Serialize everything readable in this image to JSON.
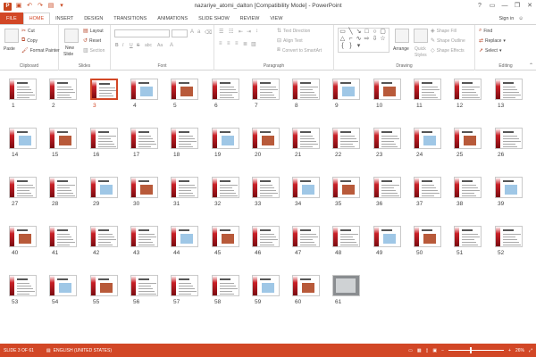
{
  "window": {
    "title": "nazariye_atomi_dalton [Compatibility Mode] - PowerPoint",
    "app_icon": "P",
    "minimize": "—",
    "restore": "❐",
    "close": "✕",
    "help": "?",
    "ribbon_toggle": "▭"
  },
  "tabs": [
    "FILE",
    "HOME",
    "INSERT",
    "DESIGN",
    "TRANSITIONS",
    "ANIMATIONS",
    "SLIDE SHOW",
    "REVIEW",
    "VIEW"
  ],
  "active_tab": "HOME",
  "signin": {
    "label": "Sign in",
    "face_glyph": "☺"
  },
  "ribbon": {
    "clipboard": {
      "paste": "Paste",
      "cut": "Cut",
      "copy": "Copy",
      "format_painter": "Format Painter",
      "label": "Clipboard"
    },
    "slides": {
      "new_slide": "New",
      "new_slide_2": "Slide",
      "layout": "Layout",
      "reset": "Reset",
      "section": "Section",
      "label": "Slides"
    },
    "font": {
      "font_name": "",
      "font_size": "",
      "bold": "B",
      "italic": "I",
      "underline": "U",
      "strike": "S",
      "abc": "abc",
      "aa": "Aa",
      "label": "Font"
    },
    "paragraph": {
      "text_direction": "Text Direction",
      "align_text": "Align Text",
      "smartart": "Convert to SmartArt",
      "label": "Paragraph"
    },
    "drawing": {
      "arrange": "Arrange",
      "quick_styles": "Quick",
      "quick_styles_2": "Styles",
      "shape_fill": "Shape Fill",
      "shape_outline": "Shape Outline",
      "shape_effects": "Shape Effects",
      "label": "Drawing"
    },
    "editing": {
      "find": "Find",
      "replace": "Replace",
      "select": "Select",
      "label": "Editing"
    }
  },
  "slides": {
    "total": 61,
    "selected": 3,
    "numbers": [
      "1",
      "2",
      "3",
      "4",
      "5",
      "6",
      "7",
      "8",
      "9",
      "10",
      "11",
      "12",
      "13",
      "14",
      "15",
      "16",
      "17",
      "18",
      "19",
      "20",
      "21",
      "22",
      "23",
      "24",
      "25",
      "26",
      "27",
      "28",
      "29",
      "30",
      "31",
      "32",
      "33",
      "34",
      "35",
      "36",
      "37",
      "38",
      "39",
      "40",
      "41",
      "42",
      "43",
      "44",
      "45",
      "46",
      "47",
      "48",
      "49",
      "50",
      "51",
      "52",
      "53",
      "54",
      "55",
      "56",
      "57",
      "58",
      "59",
      "60",
      "61"
    ]
  },
  "status": {
    "slide_info": "SLIDE 3 OF 61",
    "language": "ENGLISH (UNITED STATES)",
    "zoom": "26%",
    "zoom_fraction": 0.4,
    "zoom_out": "−",
    "zoom_in": "+"
  },
  "colors": {
    "accent": "#d24726",
    "slide_band": "#c92027"
  }
}
